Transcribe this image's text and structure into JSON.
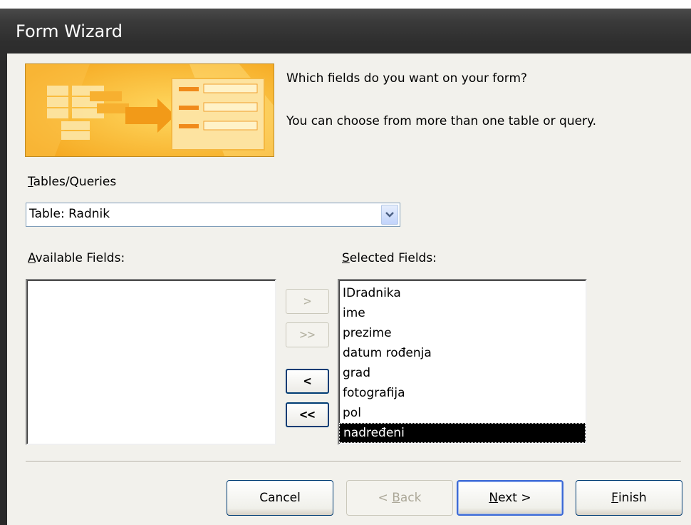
{
  "window": {
    "title": "Form Wizard"
  },
  "prompt": {
    "question": "Which fields do you want on your form?",
    "hint": "You can choose from more than one table or query."
  },
  "tables_queries": {
    "label_prefix": "T",
    "label_rest": "ables/Queries",
    "value": "Table: Radnik"
  },
  "available_fields": {
    "label_prefix": "A",
    "label_rest": "vailable Fields:",
    "items": []
  },
  "selected_fields": {
    "label_prefix": "S",
    "label_rest": "elected Fields:",
    "items": [
      "IDradnika",
      "ime",
      "prezime",
      "datum rođenja",
      "grad",
      "fotografija",
      "pol",
      "nadređeni"
    ],
    "selected_item": "nadređeni"
  },
  "move_buttons": {
    "add_one": ">",
    "add_all": ">>",
    "remove_one": "<",
    "remove_all": "<<"
  },
  "footer": {
    "cancel": "Cancel",
    "back_prefix": "< ",
    "back_hotkey": "B",
    "back_rest": "ack",
    "next_hotkey": "N",
    "next_rest": "ext >",
    "finish_hotkey": "F",
    "finish_rest": "inish"
  },
  "colors": {
    "titlebar": "#2e2e2e",
    "dialog_bg": "#f2f1ec",
    "banner_orange": "#f8b830",
    "selection": "#000000"
  }
}
